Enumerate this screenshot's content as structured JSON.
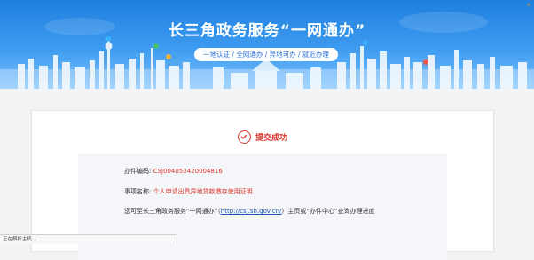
{
  "banner": {
    "title": "长三角政务服务“一网通办”",
    "tagline": "一地认证 / 全网通办 / 异地可办 / 就近办理"
  },
  "result": {
    "status": "提交成功"
  },
  "details": {
    "case_no_label": "办件编码:",
    "case_no_value": "CSJ004053420004816",
    "item_label": "事项名称:",
    "item_value": "个人申请出具异地贷款缴存使用证明",
    "note_prefix": "您可至长三角政务服务“一网通办”（",
    "note_link": "http://csj.sh.gov.cn/",
    "note_suffix": "）主页或“办件中心”查询办理进度"
  },
  "statusbar": {
    "text": "正在解析主机..."
  },
  "colors": {
    "accent_red": "#d9352c",
    "banner_blue": "#1f7fde",
    "link_blue": "#1a55b6"
  }
}
